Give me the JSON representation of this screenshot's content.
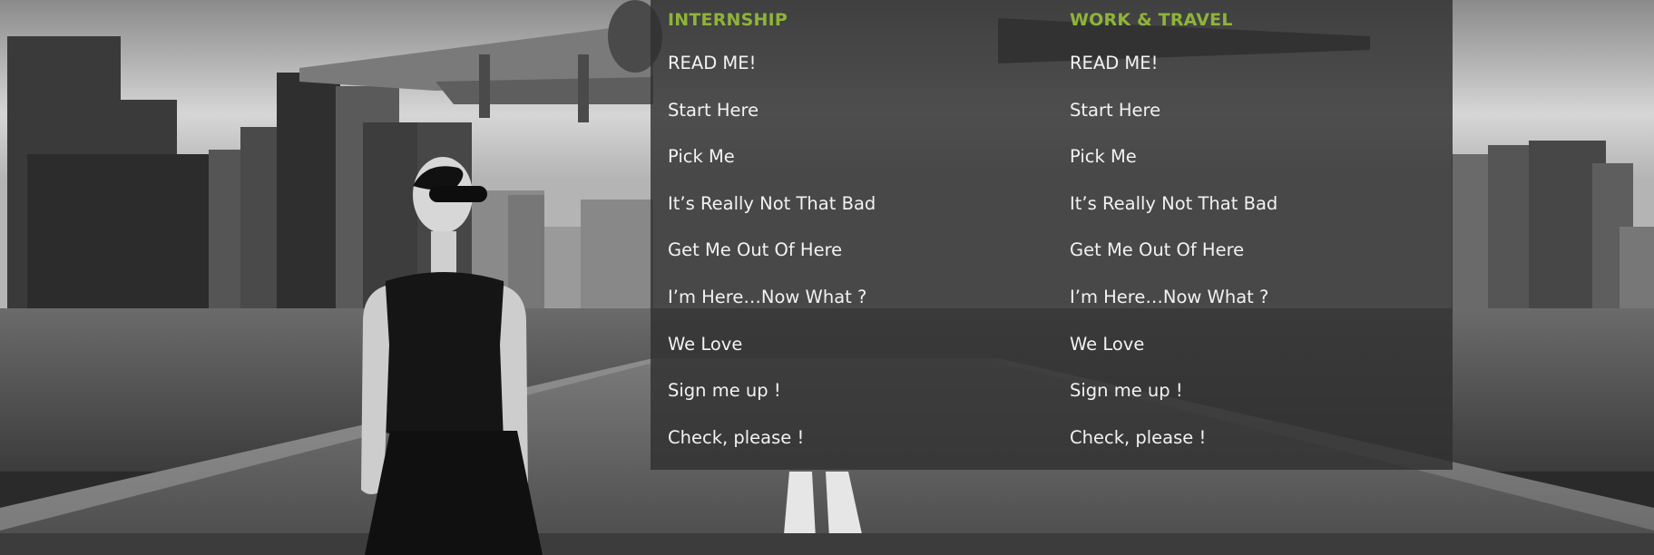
{
  "menu": {
    "columns": [
      {
        "heading": "INTERNSHIP",
        "items": [
          "READ ME!",
          "Start Here",
          "Pick Me",
          "It’s Really Not That Bad",
          "Get Me Out Of Here",
          "I’m Here…Now What ?",
          "We Love",
          "Sign me up !",
          "Check, please !"
        ]
      },
      {
        "heading": "WORK & TRAVEL",
        "items": [
          "READ ME!",
          "Start Here",
          "Pick Me",
          "It’s Really Not That Bad",
          "Get Me Out Of Here",
          "I’m Here…Now What ?",
          "We Love",
          "Sign me up !",
          "Check, please !"
        ]
      }
    ]
  },
  "colors": {
    "heading_accent": "#8fb339",
    "menu_text": "#f2f2f2",
    "panel_background": "#303030"
  },
  "background": {
    "description_icon": "hero-photo"
  }
}
